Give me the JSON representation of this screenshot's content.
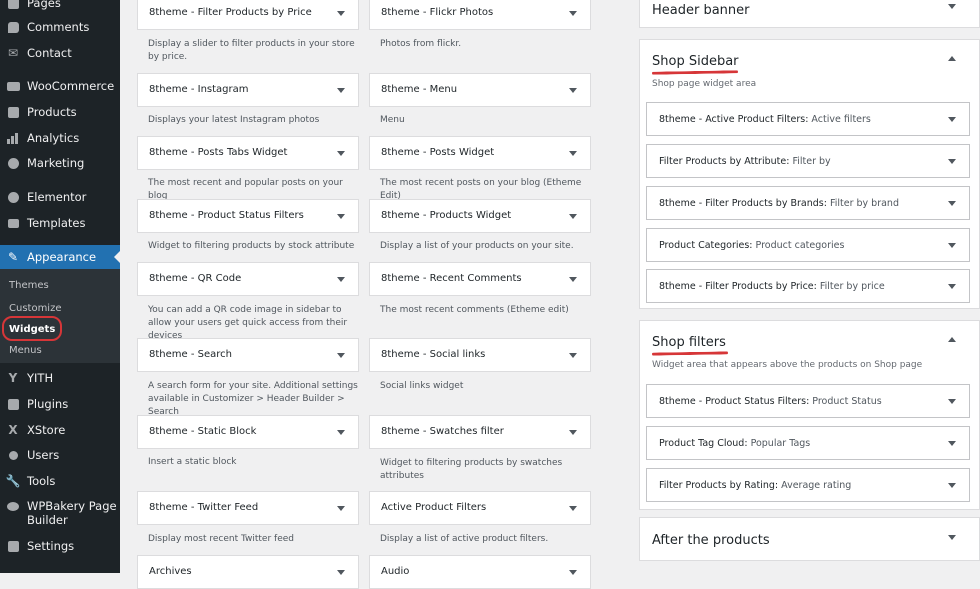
{
  "admin_menu": {
    "items": [
      {
        "label": "Pages",
        "icon": "pages-icon"
      },
      {
        "label": "Comments",
        "icon": "comments-icon"
      },
      {
        "label": "Contact",
        "icon": "mail-icon"
      },
      {
        "label": "WooCommerce",
        "icon": "woocommerce-icon"
      },
      {
        "label": "Products",
        "icon": "products-icon"
      },
      {
        "label": "Analytics",
        "icon": "analytics-icon"
      },
      {
        "label": "Marketing",
        "icon": "megaphone-icon"
      },
      {
        "label": "Elementor",
        "icon": "elementor-icon"
      },
      {
        "label": "Templates",
        "icon": "folder-icon"
      },
      {
        "label": "Appearance",
        "icon": "brush-icon"
      },
      {
        "label": "YITH",
        "icon": "yith-icon"
      },
      {
        "label": "Plugins",
        "icon": "plugin-icon"
      },
      {
        "label": "XStore",
        "icon": "xstore-icon"
      },
      {
        "label": "Users",
        "icon": "users-icon"
      },
      {
        "label": "Tools",
        "icon": "wrench-icon"
      },
      {
        "label": "WPBakery Page",
        "label2": "Builder",
        "icon": "wpbakery-icon"
      },
      {
        "label": "Settings",
        "icon": "settings-icon"
      }
    ],
    "appearance_submenu": [
      "Themes",
      "Customize",
      "Widgets",
      "Menus"
    ],
    "current_submenu": "Widgets"
  },
  "available_widgets": {
    "left": [
      {
        "title": "8theme - Filter Products by Price",
        "desc": "Display a slider to filter products in your store by price."
      },
      {
        "title": "8theme - Instagram",
        "desc": "Displays your latest Instagram photos"
      },
      {
        "title": "8theme - Posts Tabs Widget",
        "desc": "The most recent and popular posts on your blog"
      },
      {
        "title": "8theme - Product Status Filters",
        "desc": "Widget to filtering products by stock attribute"
      },
      {
        "title": "8theme - QR Code",
        "desc": "You can add a QR code image in sidebar to allow your users get quick access from their devices"
      },
      {
        "title": "8theme - Search",
        "desc": "A search form for your site. Additional settings available in Customizer > Header Builder > Search"
      },
      {
        "title": "8theme - Static Block",
        "desc": "Insert a static block"
      },
      {
        "title": "8theme - Twitter Feed",
        "desc": "Display most recent Twitter feed"
      },
      {
        "title": "Archives",
        "desc": ""
      }
    ],
    "right": [
      {
        "title": "8theme - Flickr Photos",
        "desc": "Photos from flickr."
      },
      {
        "title": "8theme - Menu",
        "desc": "Menu"
      },
      {
        "title": "8theme - Posts Widget",
        "desc": "The most recent posts on your blog (Etheme Edit)"
      },
      {
        "title": "8theme - Products Widget",
        "desc": "Display a list of your products on your site."
      },
      {
        "title": "8theme - Recent Comments",
        "desc": "The most recent comments (Etheme edit)"
      },
      {
        "title": "8theme - Social links",
        "desc": "Social links widget"
      },
      {
        "title": "8theme - Swatches filter",
        "desc": "Widget to filtering products by swatches attributes"
      },
      {
        "title": "Active Product Filters",
        "desc": "Display a list of active product filters."
      },
      {
        "title": "Audio",
        "desc": ""
      }
    ]
  },
  "sidebars": {
    "header_banner": {
      "title": "Header banner"
    },
    "shop_sidebar": {
      "title": "Shop Sidebar",
      "desc": "Shop page widget area",
      "widgets": [
        {
          "name": "8theme - Active Product Filters",
          "sub": "Active filters"
        },
        {
          "name": "Filter Products by Attribute",
          "sub": "Filter by"
        },
        {
          "name": "8theme - Filter Products by Brands",
          "sub": "Filter by brand"
        },
        {
          "name": "Product Categories",
          "sub": "Product categories"
        },
        {
          "name": "8theme - Filter Products by Price",
          "sub": "Filter by price"
        }
      ]
    },
    "shop_filters": {
      "title": "Shop filters",
      "desc": "Widget area that appears above the products on Shop page",
      "widgets": [
        {
          "name": "8theme - Product Status Filters",
          "sub": "Product Status"
        },
        {
          "name": "Product Tag Cloud",
          "sub": "Popular Tags"
        },
        {
          "name": "Filter Products by Rating",
          "sub": "Average rating"
        }
      ]
    },
    "after_products": {
      "title": "After the products"
    }
  },
  "colors": {
    "sidebar_bg": "#1d2327",
    "accent": "#2271b1",
    "annotation_red": "#d63638"
  }
}
